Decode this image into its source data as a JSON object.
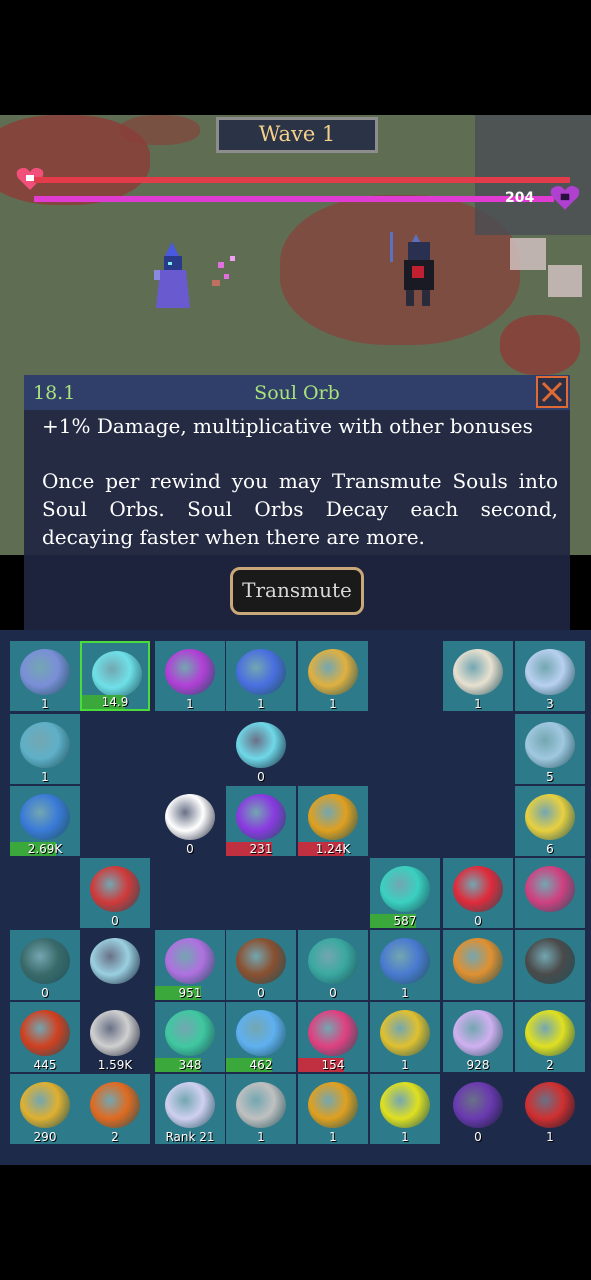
{
  "hud": {
    "wave_label": "Wave 1",
    "shield_value": "204",
    "colors": {
      "hp": "#e23b4a",
      "shield": "#e03bd2"
    }
  },
  "icons": {
    "hp_icon": "heart-icon",
    "shield_icon": "purple-heart-icon",
    "close_icon": "close-x-icon"
  },
  "panel": {
    "level": "18.1",
    "title": "Soul Orb",
    "desc_line1": "+1% Damage, multiplicative with other bonuses",
    "desc_para2": "Once per rewind you may Transmute Souls into Soul Orbs. Soul Orbs Decay each second, decaying faster when there are more.",
    "button_label": "Transmute"
  },
  "inventory": {
    "rows": [
      [
        {
          "name": "cog-orb",
          "count": "1",
          "color": "#7a8fd8"
        },
        {
          "name": "soul-orb",
          "count": "14.9",
          "color": "#6fe0e8",
          "selected": true,
          "bar": "green"
        },
        {
          "name": "shadow-sigil",
          "count": "1",
          "color": "#b23fd6"
        },
        {
          "name": "galaxy-orb",
          "count": "1",
          "color": "#4a6fe0"
        },
        {
          "name": "wheat-vase",
          "count": "1",
          "color": "#e0b040"
        },
        {
          "name": "empty",
          "count": ""
        },
        {
          "name": "rune-circle",
          "count": "1",
          "color": "#e8e0d0"
        },
        {
          "name": "crystal-pyramid",
          "count": "3",
          "color": "#b8d0f0"
        }
      ],
      [
        {
          "name": "storm-tile",
          "count": "1",
          "color": "#5fb0c8"
        },
        {
          "name": "empty",
          "count": ""
        },
        {
          "name": "empty",
          "count": ""
        },
        {
          "name": "ghost-skull",
          "count": "0",
          "color": "#6fd8e8",
          "dark": true
        },
        {
          "name": "empty",
          "count": ""
        },
        {
          "name": "empty",
          "count": ""
        },
        {
          "name": "empty",
          "count": ""
        },
        {
          "name": "meteor-staff",
          "count": "5",
          "color": "#a0c8e0"
        }
      ],
      [
        {
          "name": "blue-gem",
          "count": "2.69K",
          "color": "#3a7ad8",
          "bar": "green"
        },
        {
          "name": "empty",
          "count": ""
        },
        {
          "name": "xp-badge",
          "count": "0",
          "color": "#ffffff",
          "dark": true
        },
        {
          "name": "purple-hexgem",
          "count": "231",
          "color": "#8a3ae0",
          "bar": "red"
        },
        {
          "name": "gold-coin",
          "count": "1.24K",
          "color": "#e0a020",
          "bar": "red"
        },
        {
          "name": "empty",
          "count": ""
        },
        {
          "name": "empty",
          "count": ""
        },
        {
          "name": "golden-leaves",
          "count": "6",
          "color": "#e8d040"
        }
      ],
      [
        {
          "name": "empty",
          "count": ""
        },
        {
          "name": "berry-orb",
          "count": "0",
          "color": "#d03a3a"
        },
        {
          "name": "empty",
          "count": ""
        },
        {
          "name": "empty",
          "count": ""
        },
        {
          "name": "empty",
          "count": ""
        },
        {
          "name": "ghost-spirit",
          "count": "587",
          "color": "#3ad0c0",
          "bar": "green"
        },
        {
          "name": "broken-heart",
          "count": "0",
          "color": "#e02a3a"
        },
        {
          "name": "shop-stall",
          "count": "",
          "color": "#d04080"
        }
      ],
      [
        {
          "name": "dark-pot",
          "count": "0",
          "color": "#3a6a6a"
        },
        {
          "name": "frost-gear",
          "count": "",
          "color": "#9ad0e0",
          "dark": true
        },
        {
          "name": "black-hole",
          "count": "951",
          "color": "#b070e0",
          "bar": "green"
        },
        {
          "name": "potion-bag",
          "count": "0",
          "color": "#8a5030"
        },
        {
          "name": "teal-table",
          "count": "0",
          "color": "#3aa8a0"
        },
        {
          "name": "potion-ring",
          "count": "1",
          "color": "#4a7ad0"
        },
        {
          "name": "treasure-chest",
          "count": "",
          "color": "#e09030"
        },
        {
          "name": "witch-hat",
          "count": "",
          "color": "#4a4a4a"
        }
      ],
      [
        {
          "name": "lightning-orb",
          "count": "445",
          "color": "#d04020"
        },
        {
          "name": "silver-tree",
          "count": "1.59K",
          "color": "#d0d0d0",
          "dark": true
        },
        {
          "name": "green-crystal",
          "count": "348",
          "color": "#40c8a0",
          "bar": "green"
        },
        {
          "name": "snowflake",
          "count": "462",
          "color": "#5fb0f0",
          "bar": "green"
        },
        {
          "name": "pink-lantern",
          "count": "154",
          "color": "#e04080",
          "bar": "red"
        },
        {
          "name": "gold-hands",
          "count": "1",
          "color": "#e0c030"
        },
        {
          "name": "ghost-eye",
          "count": "928",
          "color": "#d0b0f0"
        },
        {
          "name": "gold-rune",
          "count": "2",
          "color": "#e0e020"
        }
      ],
      [
        {
          "name": "gold-chalice",
          "count": "290",
          "color": "#e0b030"
        },
        {
          "name": "orange-skull",
          "count": "2",
          "color": "#e06a20"
        },
        {
          "name": "rank-tome",
          "count": "Rank 21",
          "color": "#d0d0f0"
        },
        {
          "name": "silver-wheel",
          "count": "1",
          "color": "#c0c0c0"
        },
        {
          "name": "gold-spiral",
          "count": "1",
          "color": "#e0a020"
        },
        {
          "name": "yellow-hands",
          "count": "1",
          "color": "#e0e020"
        },
        {
          "name": "purple-spirits",
          "count": "0",
          "color": "#6a3ab0",
          "dark": true
        },
        {
          "name": "red-wand",
          "count": "1",
          "color": "#d03030",
          "dark": true
        }
      ]
    ]
  }
}
